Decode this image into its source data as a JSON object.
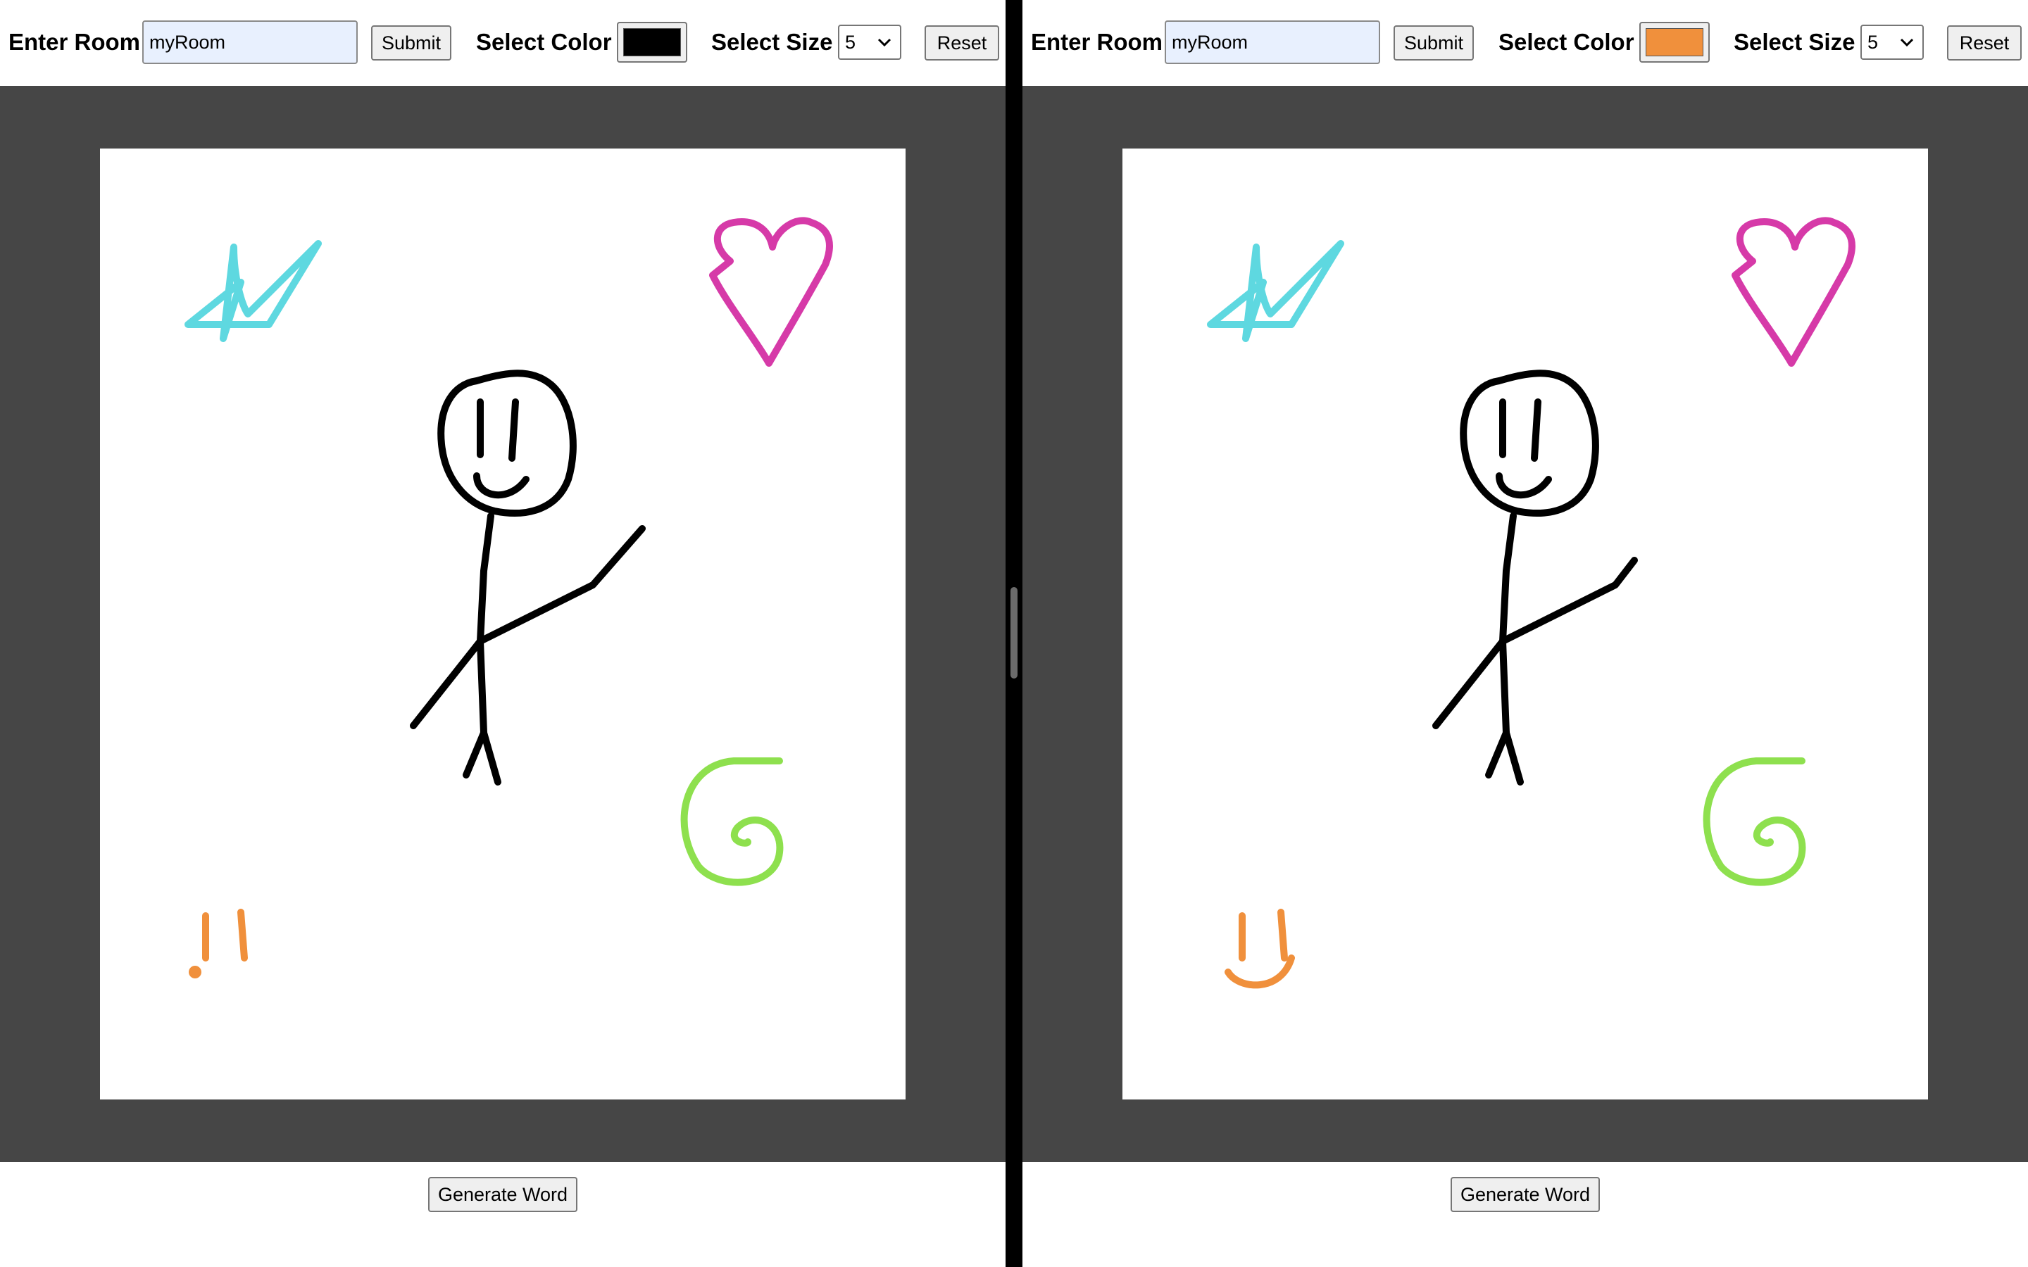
{
  "panes": [
    {
      "room_label": "Enter Room",
      "room_value": "myRoom",
      "submit_label": "Submit",
      "color_label": "Select Color",
      "selected_color": "#000000",
      "size_label": "Select Size",
      "size_value": "5",
      "reset_label": "Reset",
      "generate_label": "Generate Word"
    },
    {
      "room_label": "Enter Room",
      "room_value": "myRoom",
      "submit_label": "Submit",
      "color_label": "Select Color",
      "selected_color": "#f0903c",
      "size_label": "Select Size",
      "size_value": "5",
      "reset_label": "Reset",
      "generate_label": "Generate Word"
    }
  ],
  "colors": {
    "canvas_background": "#ffffff",
    "stage_background": "#464646",
    "stroke_black": "#000000",
    "stroke_cyan": "#5ed8e0",
    "stroke_magenta": "#d63aa8",
    "stroke_green": "#8ee04e",
    "stroke_orange": "#f0903c"
  }
}
